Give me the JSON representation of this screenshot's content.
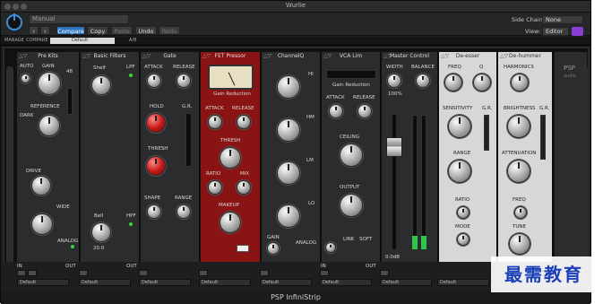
{
  "window": {
    "title": "Wurlie"
  },
  "toolbar": {
    "preset_value": "Manual",
    "buttons": [
      {
        "name": "compare-button",
        "label": "Compare"
      },
      {
        "name": "copy-button",
        "label": "Copy"
      },
      {
        "name": "paste-button",
        "label": "Paste"
      },
      {
        "name": "undo-button",
        "label": "Undo"
      },
      {
        "name": "redo-button",
        "label": "Redo"
      }
    ],
    "sidechain_label": "Side Chain:",
    "sidechain_value": "None",
    "view_label": "View:",
    "view_value": "Editor"
  },
  "plugin_bar": {
    "manage": "MANAGE",
    "compare": "COMPARE",
    "preset": "Default",
    "ab": "A/B"
  },
  "modules": [
    {
      "title": "Pre Kits",
      "labels": [
        "AUTO",
        "GAIN",
        "48",
        "REFERENCE",
        "DARK",
        "DRIVE",
        "WIDE",
        "ANALOG"
      ]
    },
    {
      "title": "Basic Filters",
      "labels": [
        "LPF",
        "HPF",
        "Shelf",
        "Bell",
        "20.0"
      ]
    },
    {
      "title": "Gate",
      "labels": [
        "ATTACK",
        "RELEASE",
        "HOLD",
        "G.R.",
        "THRESH",
        "SHAPE",
        "RANGE"
      ]
    },
    {
      "title": "FET Pressor",
      "labels": [
        "Gain Reduction",
        "ATTACK",
        "RELEASE",
        "THRESH",
        "RATIO",
        "MIX",
        "MAKEUP"
      ]
    },
    {
      "title": "ChannelQ",
      "labels": [
        "HI",
        "HM",
        "LM",
        "LO",
        "GAIN",
        "ANALOG"
      ]
    },
    {
      "title": "VCA Lim",
      "labels": [
        "Gain Reduction",
        "ATTACK",
        "RELEASE",
        "CEILING",
        "OUTPUT",
        "LINK",
        "SOFT"
      ]
    },
    {
      "title": "Master Control",
      "labels": [
        "WIDTH",
        "BALANCE",
        "100%",
        "0.0dB"
      ]
    },
    {
      "title": "De-esser",
      "labels": [
        "FREQ",
        "Q",
        "SENSITIVITY",
        "G.R.",
        "RANGE",
        "RATIO",
        "MODE"
      ]
    },
    {
      "title": "De-hummer",
      "labels": [
        "HARMONICS",
        "BRIGHTNESS",
        "G.R.",
        "ATTENUATION",
        "FREQ",
        "TUNE"
      ]
    }
  ],
  "logo": {
    "text": "PSP",
    "sub": "audio"
  },
  "footer": {
    "in": "IN",
    "out": "OUT",
    "preset": "Default"
  },
  "bottom": {
    "title": "PSP InfiniStrip"
  },
  "watermark": {
    "text": "最需教育"
  },
  "colors": {
    "accent": "#2f74c0",
    "fet_red": "#8a1414",
    "deesser": "#d7d7d7",
    "power": "#3d8ed8"
  }
}
